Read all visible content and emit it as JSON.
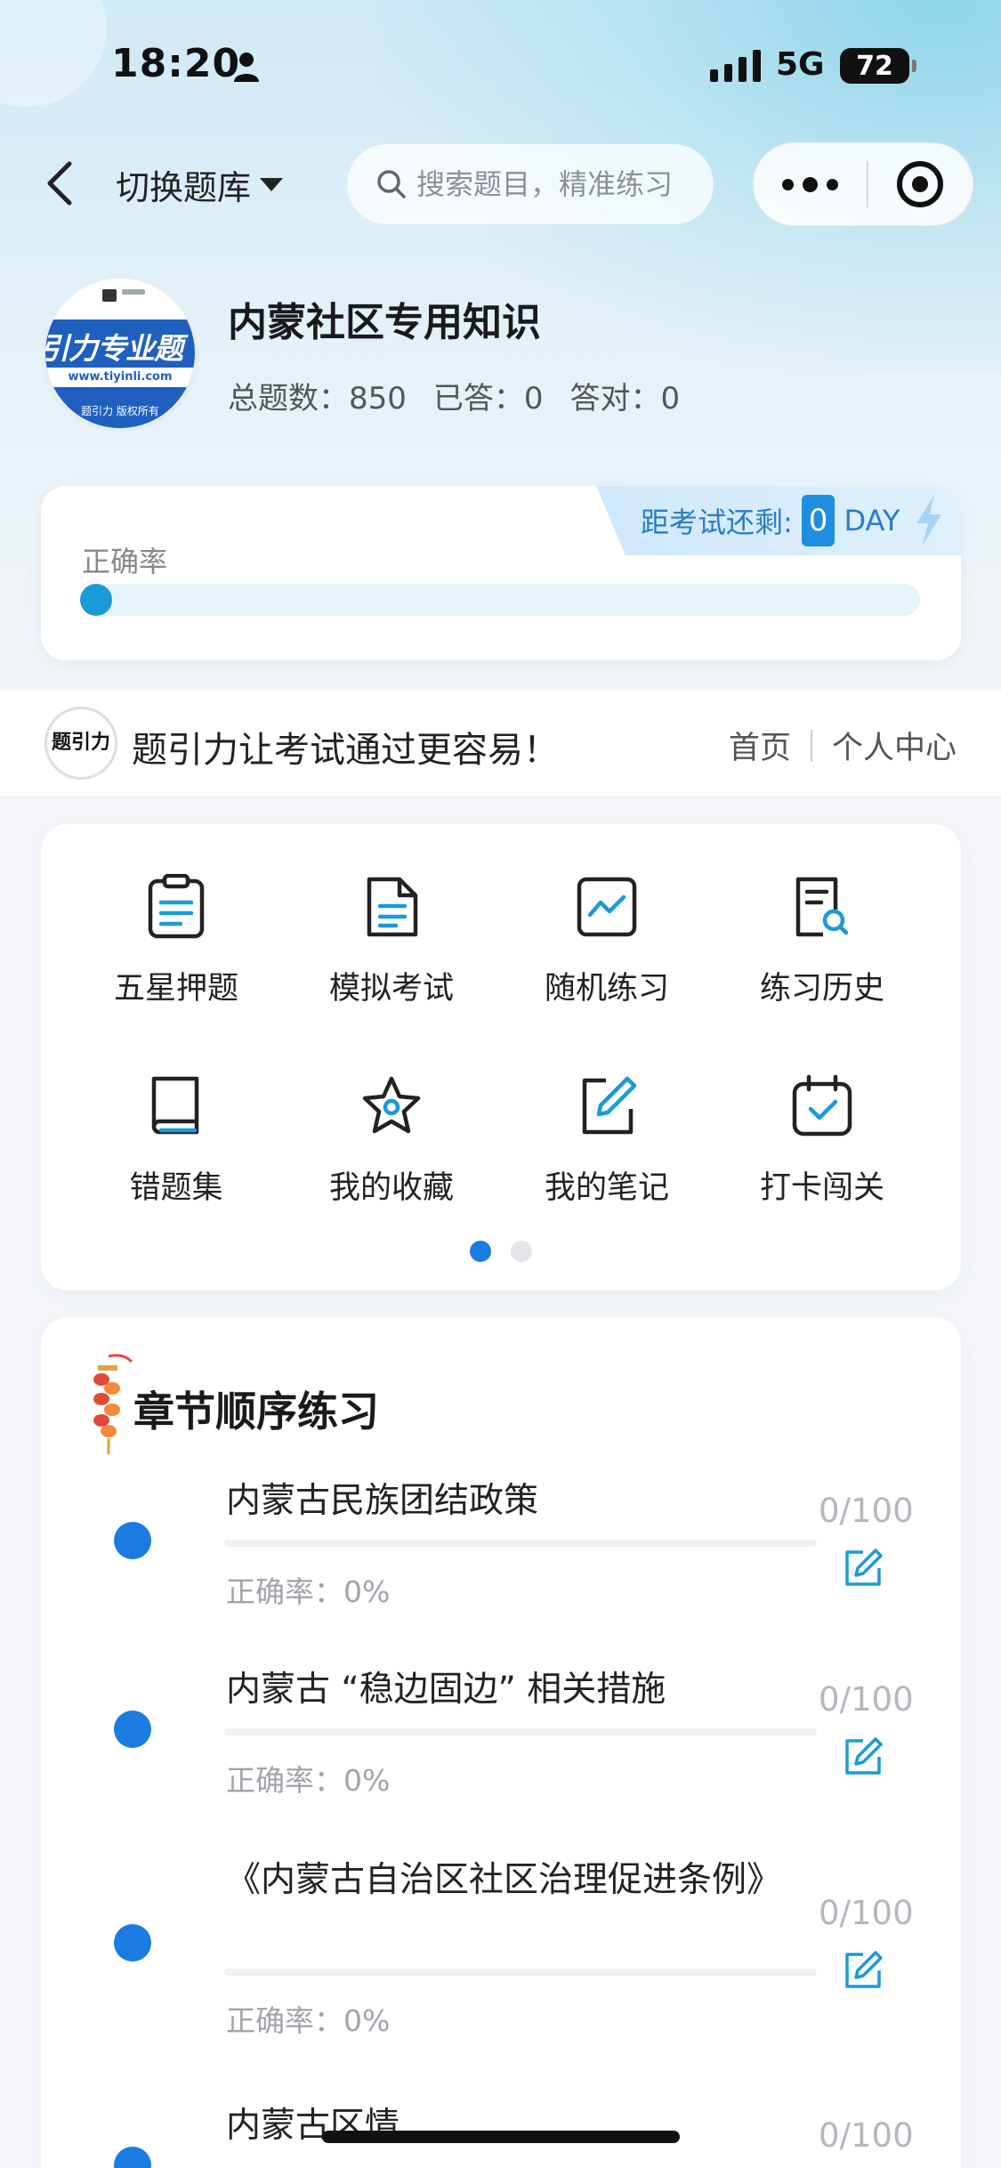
{
  "status_bar": {
    "time": "18:20",
    "network": "5G",
    "battery": "72"
  },
  "nav": {
    "switch_label": "切换题库",
    "search_placeholder": "搜索题目，精准练习"
  },
  "bank": {
    "logo_text": "引力专业题",
    "logo_url": "www.tiyinli.com",
    "logo_footer": "题引力 版权所有",
    "title": "内蒙社区专用知识",
    "total_label": "总题数：850",
    "answered_label": "已答：0",
    "correct_label": "答对：0"
  },
  "accuracy_card": {
    "exam_label": "距考试还剩:",
    "exam_days": "0",
    "exam_unit": "DAY",
    "accuracy_label": "正确率",
    "accuracy_value": 0
  },
  "slogan": {
    "logo_text": "题引力",
    "text": "题引力让考试通过更容易！",
    "link_home": "首页",
    "link_profile": "个人中心"
  },
  "menu": {
    "items": [
      {
        "label": "五星押题",
        "icon": "clipboard-icon"
      },
      {
        "label": "模拟考试",
        "icon": "document-icon"
      },
      {
        "label": "随机练习",
        "icon": "trend-chart-icon"
      },
      {
        "label": "练习历史",
        "icon": "history-search-icon"
      },
      {
        "label": "错题集",
        "icon": "book-icon"
      },
      {
        "label": "我的收藏",
        "icon": "star-icon"
      },
      {
        "label": "我的笔记",
        "icon": "edit-note-icon"
      },
      {
        "label": "打卡闯关",
        "icon": "calendar-check-icon"
      }
    ],
    "page_count": 2,
    "active_page": 0
  },
  "chapters": {
    "title": "章节顺序练习",
    "items": [
      {
        "name": "内蒙古民族团结政策",
        "accuracy": "正确率：0%",
        "count": "0/100"
      },
      {
        "name": "内蒙古 “稳边固边” 相关措施",
        "accuracy": "正确率：0%",
        "count": "0/100"
      },
      {
        "name": "《内蒙古自治区社区治理促进条例》",
        "accuracy": "正确率：0%",
        "count": "0/100"
      },
      {
        "name": "内蒙古区情",
        "accuracy": "",
        "count": "0/100"
      }
    ]
  },
  "colors": {
    "accent": "#1a7be0",
    "progress": "#1a9ad9",
    "icon_teal": "#1a9ad9"
  }
}
